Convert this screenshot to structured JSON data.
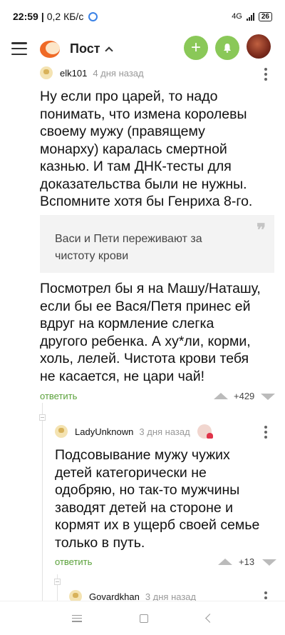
{
  "status": {
    "time": "22:59",
    "speed": "0,2 КБ/с",
    "network": "4G",
    "battery": "26"
  },
  "header": {
    "title": "Пост"
  },
  "comments": [
    {
      "author": "elk101",
      "date": "4 дня назад",
      "text_lines": [
        "Ну если про царей, то надо",
        "понимать, что измена королевы",
        "своему мужу (правящему",
        "монарху) каралась смертной",
        "казнью. И там ДНК-тесты для",
        "доказательства были не нужны.",
        "Вспомните хотя бы Генриха 8-го."
      ],
      "quote_lines": [
        "Васи и Пети переживают за",
        "чистоту крови"
      ],
      "text2_lines": [
        "Посмотрел бы я на Машу/Наташу,",
        "если бы ее Вася/Петя принес ей",
        "вдруг на кормление слегка",
        "другого ребенка.  А ху*ли, корми,",
        "холь, лелей. Чистота крови тебя",
        "не касается, не цари чай!"
      ],
      "reply_label": "ответить",
      "score": "+429"
    },
    {
      "author": "LadyUnknown",
      "date": "3 дня назад",
      "text_lines": [
        "Подсовывание мужу чужих",
        "детей категорически не",
        "одобряю, но так-то мужчины",
        "заводят детей на стороне и",
        "кормят их в ущерб своей семье",
        "только в путь."
      ],
      "reply_label": "ответить",
      "score": "+13"
    },
    {
      "author": "Govardkhan",
      "date": "3 дня назад"
    }
  ],
  "colors": {
    "accent_green": "#8ac858",
    "reply_green": "#5aa13a",
    "logo_orange": "#ef6a26"
  }
}
